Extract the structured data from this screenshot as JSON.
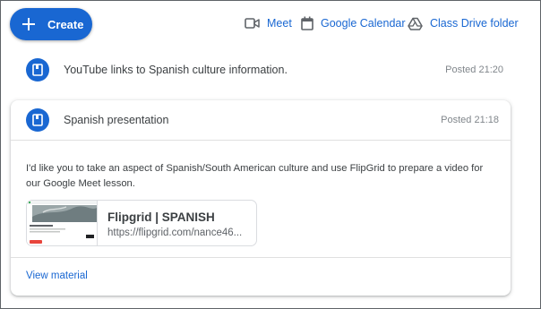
{
  "toolbar": {
    "create_label": "Create",
    "links": [
      {
        "label": "Meet",
        "icon": "video-camera-icon"
      },
      {
        "label": "Google Calendar",
        "icon": "calendar-icon"
      },
      {
        "label": "Class Drive folder",
        "icon": "drive-icon"
      }
    ]
  },
  "materials": [
    {
      "title": "YouTube links to Spanish culture information.",
      "posted": "Posted 21:20",
      "icon": "book-icon"
    },
    {
      "title": "Spanish presentation",
      "posted": "Posted 21:18",
      "icon": "book-icon",
      "description": "I'd like you to take an aspect of Spanish/South American culture and use FlipGrid to prepare a video for our Google Meet lesson.",
      "attachment": {
        "title": "Flipgrid | SPANISH",
        "url": "https://flipgrid.com/nance46..."
      },
      "view_label": "View material"
    }
  ],
  "colors": {
    "accent": "#1967d2",
    "text": "#3c4043",
    "muted": "#80868b"
  }
}
